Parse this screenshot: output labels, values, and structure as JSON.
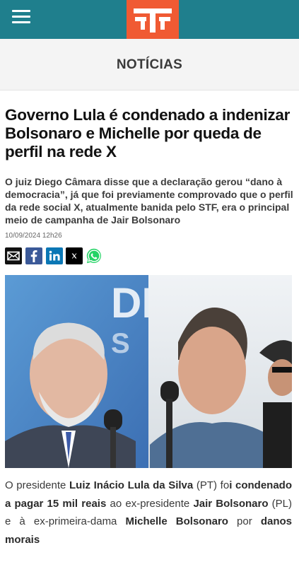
{
  "header": {
    "menu_icon": "hamburger-menu-icon",
    "logo_icon": "tvt-logo-icon",
    "colors": {
      "bar": "#1f7f8d",
      "logo": "#f05a33"
    }
  },
  "section": {
    "title": "NOTÍCIAS"
  },
  "article": {
    "headline": "Governo Lula é condenado a indenizar Bolsonaro e Michelle por queda de perfil na rede X",
    "lead": "O juiz Diego Câmara disse que a declaração gerou “dano à democracia”, já que foi previamente comprovado  que o perfil da rede social X, atualmente banida pelo STF, era o principal meio de campanha de Jair Bolsonaro",
    "date": "10/09/2024 12h26",
    "share_icons": [
      "email-icon",
      "facebook-icon",
      "linkedin-icon",
      "x-icon",
      "whatsapp-icon"
    ],
    "body": {
      "p1_a": "O presidente ",
      "p1_b": "Luiz Inácio Lula da Silva",
      "p1_c": " (PT) fo",
      "p1_d": "i condenado a pagar 15 mil reais",
      "p1_e": " ao ex-presidente ",
      "p1_f": "Jair Bolsonaro",
      "p1_g": " (PL) e à ex-primeira-dama ",
      "p1_h": "Michelle Bolsonaro",
      "p1_i": " por ",
      "p1_j": "danos morais"
    }
  }
}
